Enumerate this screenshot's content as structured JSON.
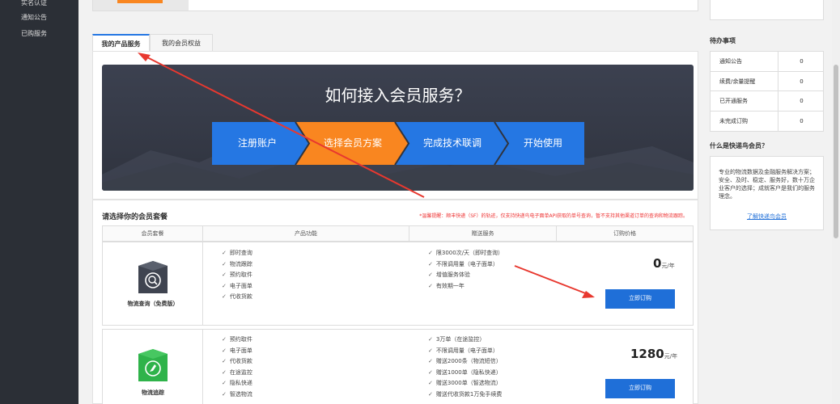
{
  "sidebar": {
    "items": [
      "实名认证",
      "通知公告",
      "已购服务"
    ]
  },
  "tabs": [
    {
      "label": "我的产品服务",
      "active": true
    },
    {
      "label": "我的会员权益",
      "active": false
    }
  ],
  "banner": {
    "title": "如何接入会员服务？",
    "steps": [
      "注册账户",
      "选择会员方案",
      "完成技术联调",
      "开始使用"
    ]
  },
  "packages": {
    "title": "请选择你的会员套餐",
    "note": "*温馨提醒：顺丰快递（SF）的轨迹，仅支持快递鸟电子面单API获取的单号查询，暂不支持其他渠道订单的查询和物流跟踪。",
    "columns": [
      "会员套餐",
      "产品功能",
      "赠送服务",
      "订购价格"
    ],
    "rows": [
      {
        "name": "物流查询（免费版）",
        "features": [
          "即时查询",
          "物流跟踪",
          "预约取件",
          "电子面单",
          "代收货款"
        ],
        "gifts": [
          "限3000次/天（即时查询）",
          "不限调用量（电子面单）",
          "增值服务体验",
          "有效期一年"
        ],
        "price": "0",
        "unit": "元/年",
        "button": "立即订购"
      },
      {
        "name": "物流追踪",
        "features": [
          "预约取件",
          "电子面单",
          "代收货款",
          "在途监控",
          "隐私快递",
          "智选物流"
        ],
        "gifts": [
          "3万单（在途监控）",
          "不限调用量（电子面单）",
          "赠送2000条（物流短信）",
          "赠送1000单（隐私快递）",
          "赠送3000单（智选物流）",
          "赠送代收货款1万免手续费"
        ],
        "price": "1280",
        "unit": "元/年",
        "button": "立即订购"
      }
    ]
  },
  "todo": {
    "title": "待办事项",
    "items": [
      {
        "label": "通知公告",
        "value": "0"
      },
      {
        "label": "续费/余量提醒",
        "value": "0"
      },
      {
        "label": "已开通服务",
        "value": "0"
      },
      {
        "label": "未完成订购",
        "value": "0"
      }
    ]
  },
  "about": {
    "title": "什么是快递鸟会员？",
    "text": "专业的物流数据及金融服务解决方案；安全、及时、稳定、服务好，数十万企业客户的选择；成就客户是我们的服务理念。",
    "link": "了解快递鸟会员"
  },
  "colors": {
    "primary": "#1f6fd8",
    "orange": "#f98620",
    "step_blue": "#2577e3",
    "annotation": "#e8382f"
  }
}
